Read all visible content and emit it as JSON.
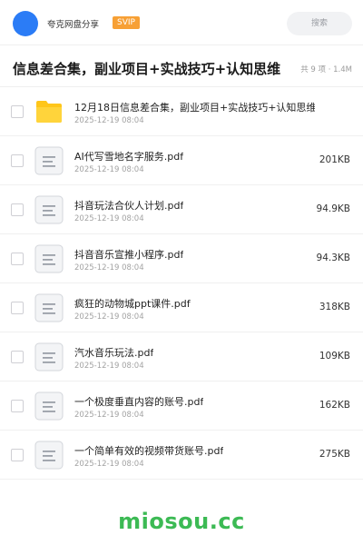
{
  "header": {
    "username": "夸克网盘分享",
    "badge": "SVIP",
    "search_placeholder": "搜索",
    "colors": {
      "avatar": "#2b7cf6",
      "badge": "#f7a035"
    }
  },
  "folder": {
    "title": "信息差合集，副业项目+实战技巧+认知思维",
    "meta": "共 9 项 · 1.4M"
  },
  "files": [
    {
      "icon": "folder-icon",
      "name": "12月18日信息差合集，副业项目+实战技巧+认知思维",
      "date": "2025-12-19 08:04",
      "size": ""
    },
    {
      "icon": "document-icon",
      "name": "AI代写雪地名字服务.pdf",
      "date": "2025-12-19 08:04",
      "size": "201KB"
    },
    {
      "icon": "document-icon",
      "name": "抖音玩法合伙人计划.pdf",
      "date": "2025-12-19 08:04",
      "size": "94.9KB"
    },
    {
      "icon": "document-icon",
      "name": "抖音音乐宣推小程序.pdf",
      "date": "2025-12-19 08:04",
      "size": "94.3KB"
    },
    {
      "icon": "document-icon",
      "name": "疯狂的动物城ppt课件.pdf",
      "date": "2025-12-19 08:04",
      "size": "318KB"
    },
    {
      "icon": "document-icon",
      "name": "汽水音乐玩法.pdf",
      "date": "2025-12-19 08:04",
      "size": "109KB"
    },
    {
      "icon": "document-icon",
      "name": "一个极度垂直内容的账号.pdf",
      "date": "2025-12-19 08:04",
      "size": "162KB"
    },
    {
      "icon": "document-icon",
      "name": "一个简单有效的视频带货账号.pdf",
      "date": "2025-12-19 08:04",
      "size": "275KB"
    }
  ],
  "watermark": "miosou.cc"
}
